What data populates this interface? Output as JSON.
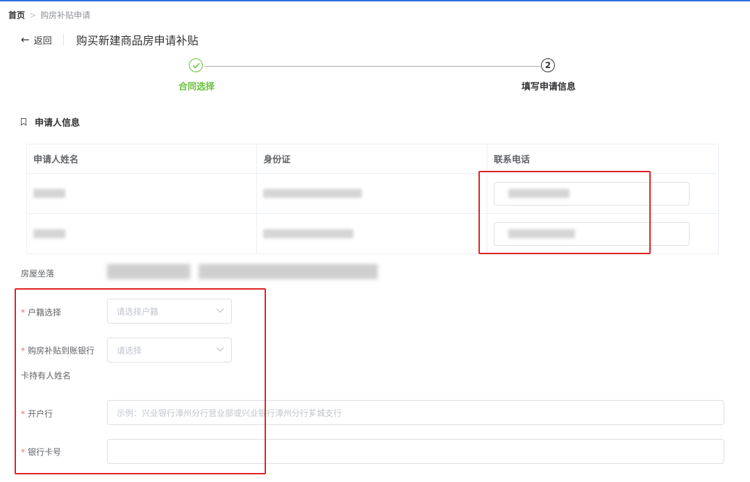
{
  "breadcrumb": {
    "home": "首页",
    "separator": ">",
    "current": "购房补贴申请"
  },
  "header": {
    "back_label": "返回",
    "title": "购买新建商品房申请补贴"
  },
  "steps": [
    {
      "label": "合同选择",
      "status": "done"
    },
    {
      "label": "填写申请信息",
      "number": "2",
      "status": "current"
    }
  ],
  "section": {
    "title": "申请人信息"
  },
  "applicant_table": {
    "columns": [
      "申请人姓名",
      "身份证",
      "联系电话"
    ],
    "rows": [
      {
        "name": "[redacted]",
        "id_card": "[redacted]",
        "phone": "[redacted]"
      },
      {
        "name": "[redacted]",
        "id_card": "[redacted]",
        "phone": "[redacted]"
      }
    ]
  },
  "house_location": {
    "label": "房屋坐落",
    "value": "[redacted]"
  },
  "form": {
    "household": {
      "label": "户籍选择",
      "required": true,
      "placeholder": "请选择户籍"
    },
    "bank": {
      "label": "购房补贴到账银行",
      "required": true,
      "placeholder": "请选择"
    },
    "cardholder": {
      "label": "卡持有人姓名",
      "required": false
    },
    "branch": {
      "label": "开户行",
      "required": true,
      "placeholder": "示例：兴业银行漳州分行营业部或兴业银行漳州分行芗城支行"
    },
    "card_no": {
      "label": "银行卡号",
      "required": true,
      "placeholder": ""
    }
  },
  "colors": {
    "accent": "#2f6de1",
    "success": "#67c23a",
    "required": "#f56c6c",
    "highlight": "#e02020"
  }
}
